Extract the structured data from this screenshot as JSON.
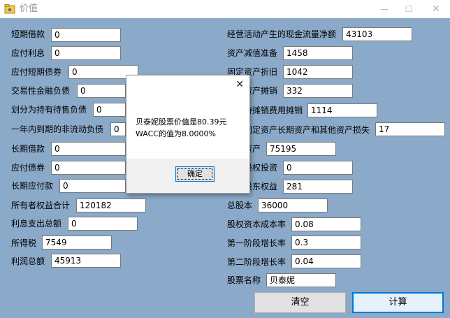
{
  "window": {
    "title": "价值",
    "minimize_glyph": "—",
    "maximize_glyph": "☐",
    "close_glyph": "✕",
    "app_icon": "folder-app-icon"
  },
  "form": {
    "left_fields": [
      {
        "label": "短期借款",
        "value": "0"
      },
      {
        "label": "应付利息",
        "value": "0"
      },
      {
        "label": "应付短期债券",
        "value": "0"
      },
      {
        "label": "交易性金融负债",
        "value": "0"
      },
      {
        "label": "划分为持有待售负债",
        "value": "0"
      },
      {
        "label": "一年内到期的非流动负债",
        "value": "0"
      },
      {
        "label": "长期借款",
        "value": "0"
      },
      {
        "label": "应付债券",
        "value": "0"
      },
      {
        "label": "长期应付款",
        "value": "0"
      },
      {
        "label": "所有者权益合计",
        "value": "120182"
      },
      {
        "label": "利息支出总额",
        "value": "0"
      },
      {
        "label": "所得税",
        "value": "7549"
      },
      {
        "label": "利润总额",
        "value": "45913"
      }
    ],
    "right_fields": [
      {
        "label": "经营活动产生的现金流量净额",
        "value": "43103"
      },
      {
        "label": "资产减值准备",
        "value": "1458"
      },
      {
        "label": "固定资产折旧",
        "value": "1042"
      },
      {
        "label": "无形资产摊销",
        "value": "332"
      },
      {
        "label": "长期待摊销费用摊销",
        "value": "1114"
      },
      {
        "label": "处置固定资产长期资产和其他资产损失",
        "value": "17"
      },
      {
        "label": "流动资产",
        "value": "75195"
      },
      {
        "label": "长期股权投资",
        "value": "0"
      },
      {
        "label": "少数股东权益",
        "value": "281"
      },
      {
        "label": "总股本",
        "value": "36000"
      },
      {
        "label": "股权资本成本率",
        "value": "0.08"
      },
      {
        "label": "第一阶段增长率",
        "value": "0.3"
      },
      {
        "label": "第二阶段增长率",
        "value": "0.04"
      },
      {
        "label": "股票名称",
        "value": "贝泰妮"
      }
    ],
    "clear_button": "清空",
    "calc_button": "计算"
  },
  "dialog": {
    "message_line1": "贝泰妮股票价值是80.39元",
    "message_line2": "WACC的值为8.0000%",
    "ok_button": "确定",
    "close_glyph": "✕"
  },
  "colors": {
    "client_background": "#8ba9c9",
    "accent": "#0078d7"
  }
}
